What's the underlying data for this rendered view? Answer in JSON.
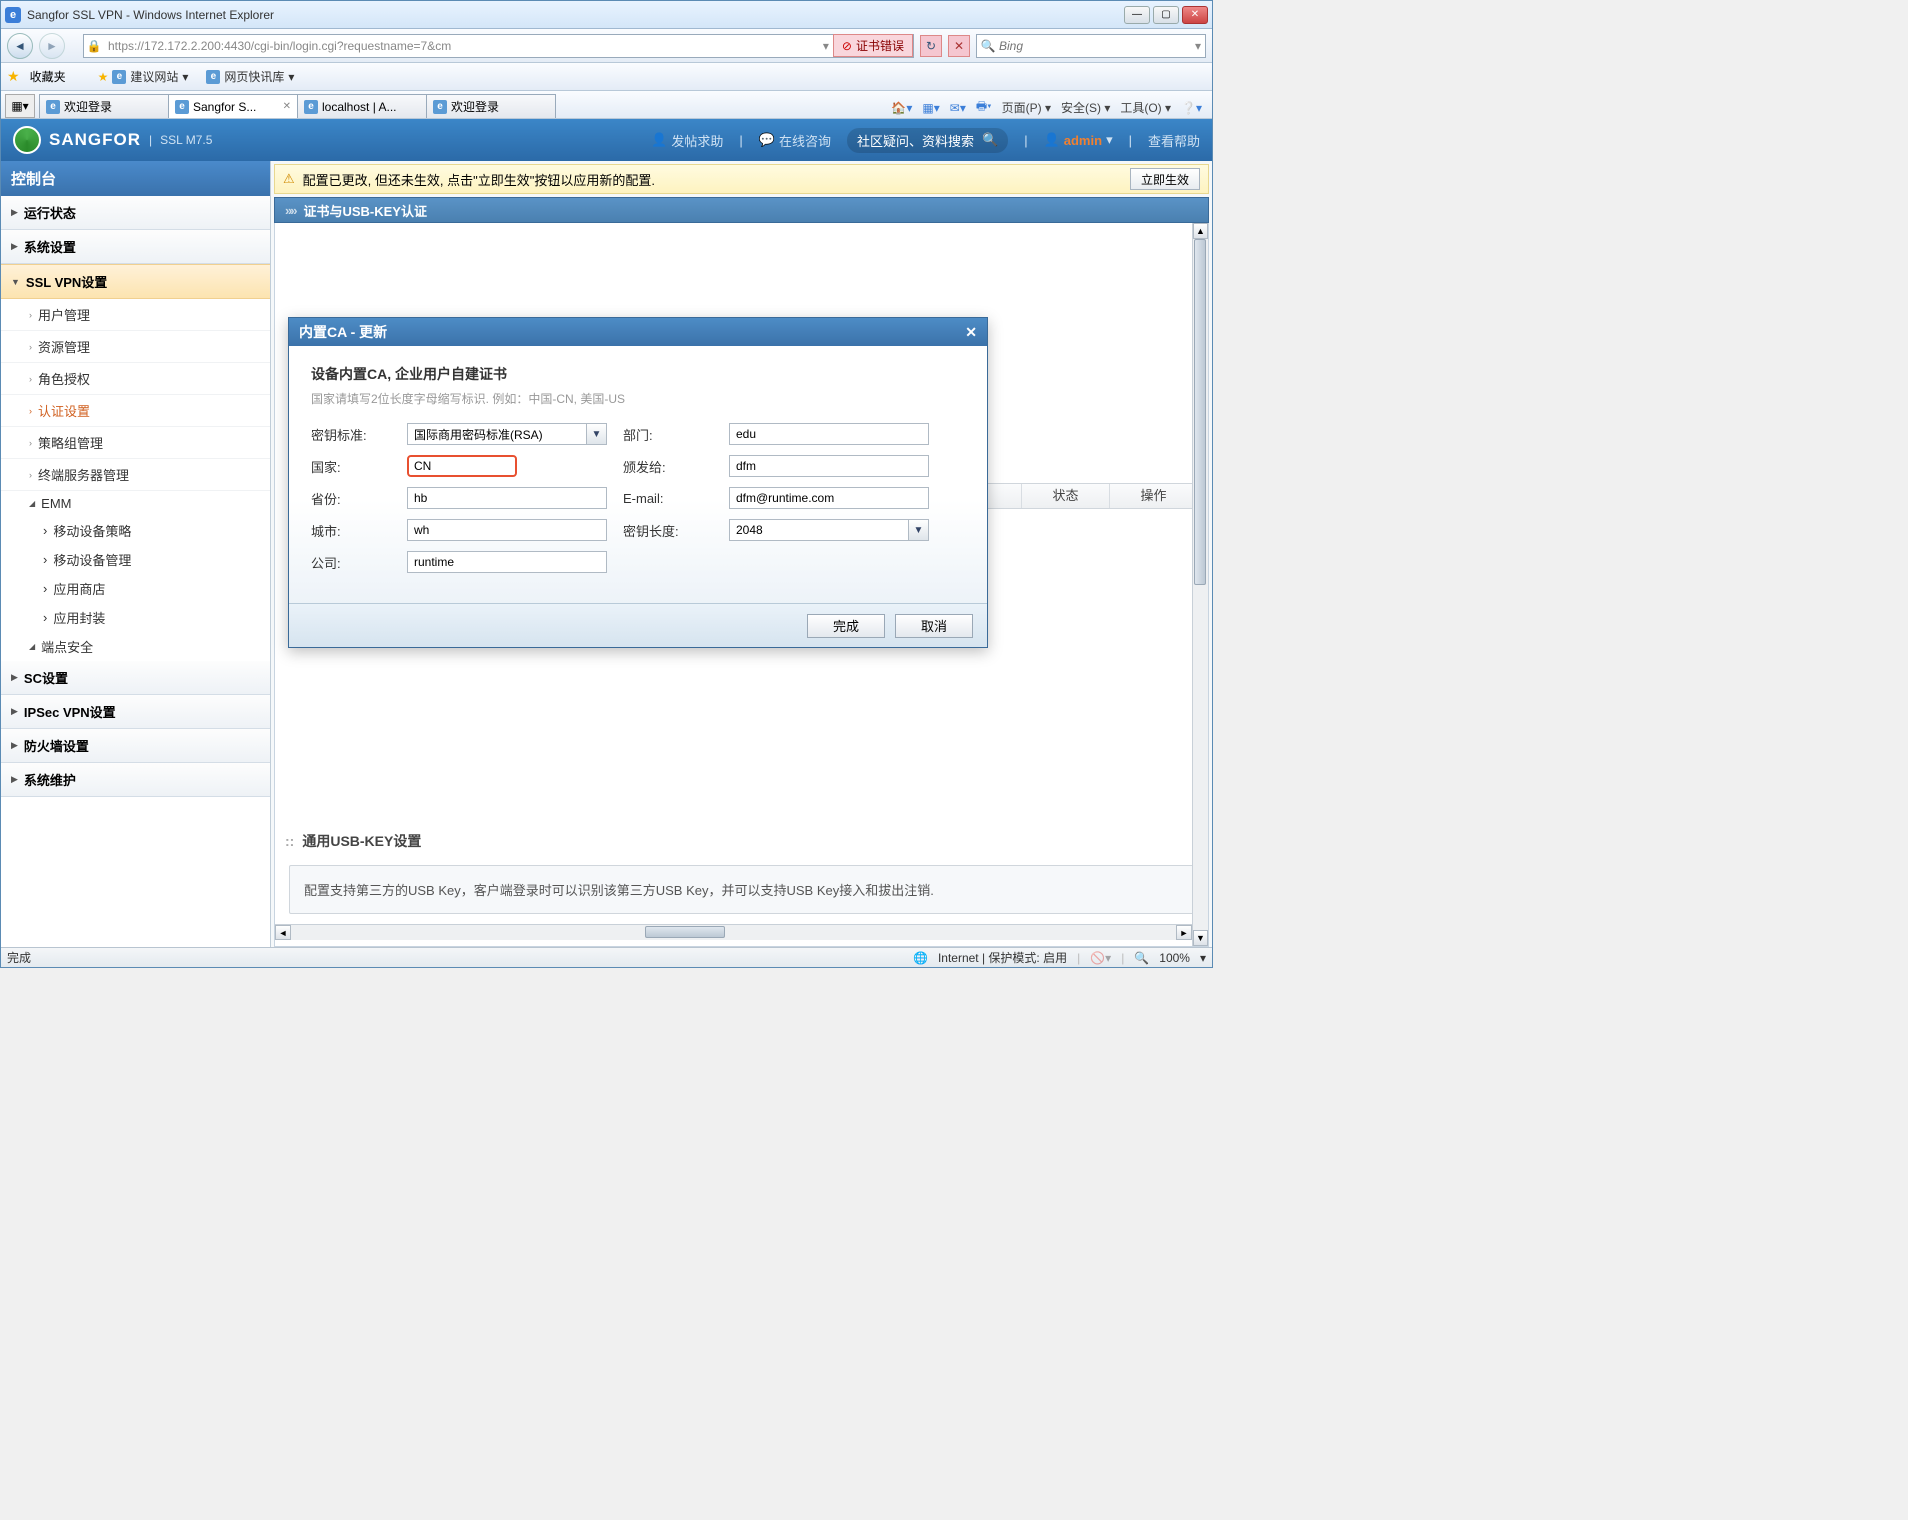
{
  "window": {
    "title": "Sangfor SSL VPN - Windows Internet Explorer"
  },
  "address": {
    "url": "https://172.172.2.200:4430/cgi-bin/login.cgi?requestname=7&cm",
    "cert_error": "证书错误",
    "search_placeholder": "Bing"
  },
  "favorites": {
    "label": "收藏夹",
    "suggest": "建议网站",
    "quick": "网页快讯库"
  },
  "tabs": [
    {
      "label": "欢迎登录"
    },
    {
      "label": "Sangfor S...",
      "active": true
    },
    {
      "label": "localhost | A..."
    },
    {
      "label": "欢迎登录"
    }
  ],
  "ie_menu": {
    "page": "页面(P)",
    "safety": "安全(S)",
    "tools": "工具(O)"
  },
  "app": {
    "brand": "SANGFOR",
    "sub": "SSL M7.5",
    "post_help": "发帖求助",
    "online_consult": "在线咨询",
    "search_ph": "社区疑问、资料搜索",
    "user": "admin",
    "view_help": "查看帮助"
  },
  "sidebar": {
    "title": "控制台",
    "sections": [
      {
        "label": "运行状态",
        "expanded": false
      },
      {
        "label": "系统设置",
        "expanded": false
      },
      {
        "label": "SSL VPN设置",
        "expanded": true,
        "children": [
          {
            "label": "用户管理"
          },
          {
            "label": "资源管理"
          },
          {
            "label": "角色授权"
          },
          {
            "label": "认证设置",
            "selected": true
          },
          {
            "label": "策略组管理"
          },
          {
            "label": "终端服务器管理"
          }
        ],
        "group_emm": {
          "label": "EMM",
          "children": [
            "移动设备策略",
            "移动设备管理",
            "应用商店",
            "应用封装"
          ]
        },
        "group_endpoint": {
          "label": "端点安全"
        }
      },
      {
        "label": "SC设置",
        "expanded": false
      },
      {
        "label": "IPSec VPN设置",
        "expanded": false
      },
      {
        "label": "防火墙设置",
        "expanded": false
      },
      {
        "label": "系统维护",
        "expanded": false
      }
    ]
  },
  "alert": {
    "text": "配置已更改, 但还未生效, 点击\"立即生效\"按钮以应用新的配置.",
    "btn": "立即生效"
  },
  "breadcrumb": "证书与USB-KEY认证",
  "table": {
    "col_state": "状态",
    "col_op": "操作"
  },
  "usb": {
    "section": "通用USB-KEY设置",
    "desc": "配置支持第三方的USB Key，客户端登录时可以识别该第三方USB Key，并可以支持USB Key接入和拔出注销."
  },
  "dialog": {
    "title": "内置CA - 更新",
    "head": "设备内置CA, 企业用户自建证书",
    "hint": "国家请填写2位长度字母缩写标识. 例如：中国-CN, 美国-US",
    "labels": {
      "key_std": "密钥标准:",
      "country": "国家:",
      "province": "省份:",
      "city": "城市:",
      "company": "公司:",
      "dept": "部门:",
      "issued_to": "颁发给:",
      "email": "E-mail:",
      "key_len": "密钥长度:"
    },
    "values": {
      "key_std": "国际商用密码标准(RSA)",
      "country": "CN",
      "province": "hb",
      "city": "wh",
      "company": "runtime",
      "dept": "edu",
      "issued_to": "dfm",
      "email": "dfm@runtime.com",
      "key_len": "2048"
    },
    "btn_ok": "完成",
    "btn_cancel": "取消"
  },
  "status": {
    "done": "完成",
    "mode": "Internet | 保护模式: 启用",
    "zoom": "100%"
  }
}
